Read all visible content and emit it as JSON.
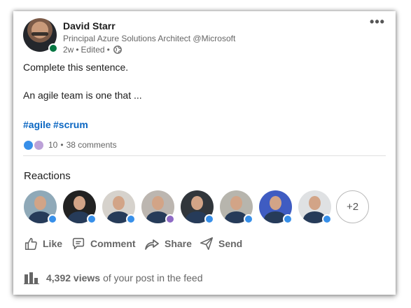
{
  "author": {
    "name": "David Starr",
    "headline": "Principal Azure Solutions Architect @Microsoft",
    "time": "2w",
    "edited": "Edited",
    "separator": "•"
  },
  "post": {
    "line1": "Complete this sentence.",
    "line2": "An agile team is one that ...",
    "hashtags": [
      "#agile",
      "#scrum"
    ]
  },
  "social": {
    "reaction_count": "10",
    "comments": "38 comments",
    "dot": "•"
  },
  "reactions": {
    "title": "Reactions",
    "more": "+2"
  },
  "actions": {
    "like": "Like",
    "comment": "Comment",
    "share": "Share",
    "send": "Send"
  },
  "views": {
    "count": "4,392 views",
    "suffix": "of your post in the feed"
  },
  "icons": {
    "more": "more-icon",
    "globe": "globe-icon",
    "like": "like-icon",
    "comment": "comment-icon",
    "share": "share-icon",
    "send": "send-icon",
    "analytics": "analytics-icon"
  },
  "colors": {
    "brand_blue": "#0a66c2",
    "online": "#057642",
    "like_badge": "#378fe9",
    "insightful_badge": "#8e6ac5"
  }
}
